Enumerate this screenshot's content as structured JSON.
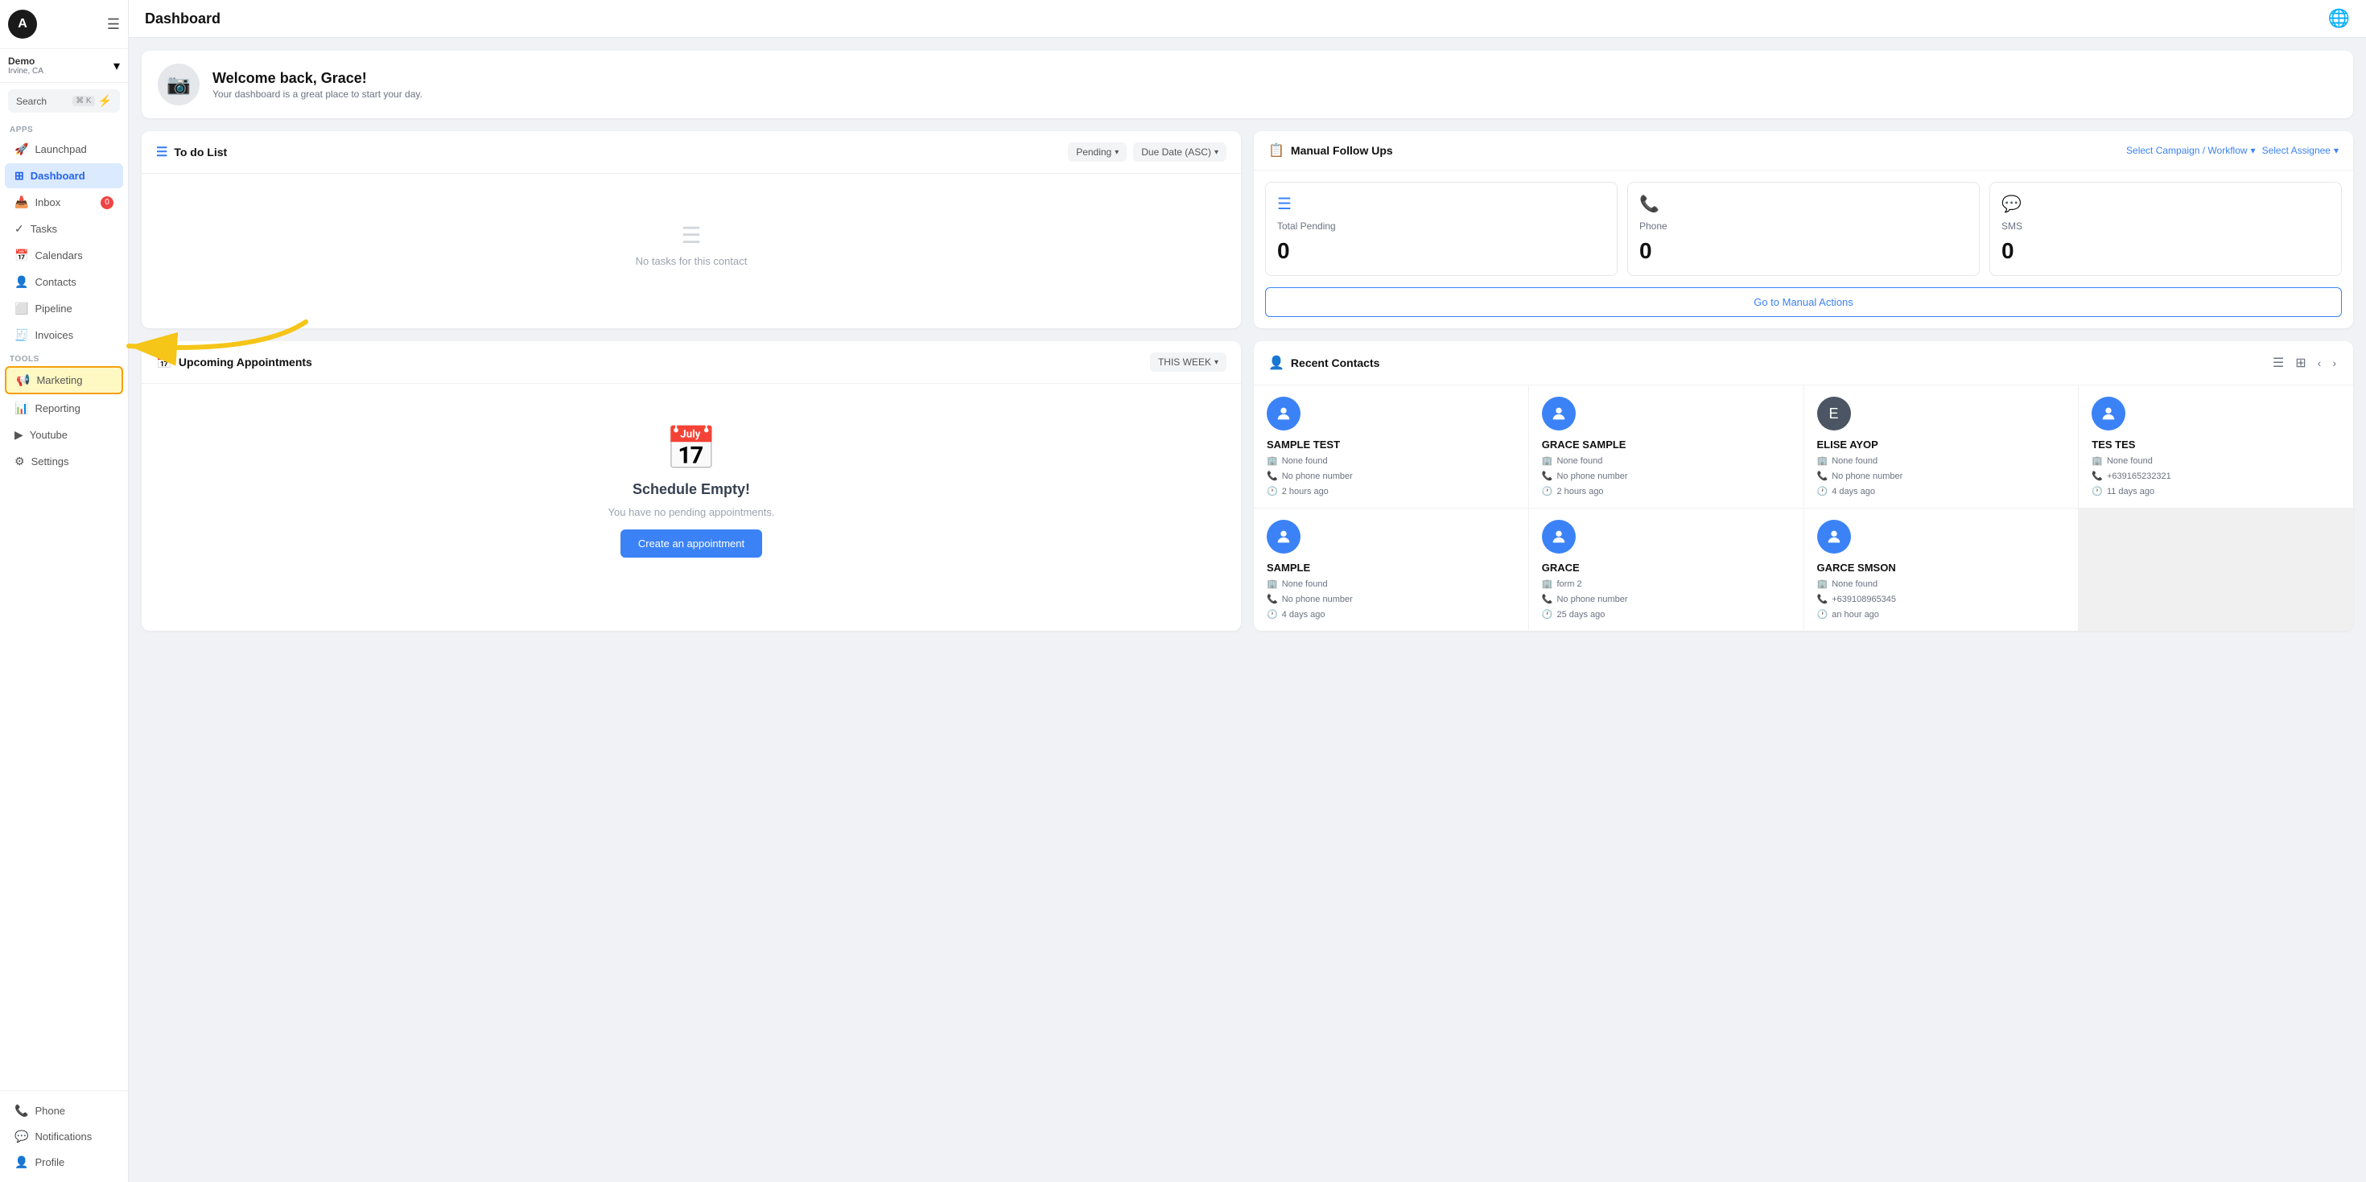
{
  "sidebar": {
    "avatar_letter": "A",
    "account": {
      "name": "Demo",
      "location": "Irvine, CA"
    },
    "search": {
      "label": "Search",
      "shortcut": "⌘ K"
    },
    "apps_label": "Apps",
    "tools_label": "Tools",
    "apps_items": [
      {
        "id": "launchpad",
        "label": "Launchpad",
        "icon": "🚀",
        "active": false
      },
      {
        "id": "dashboard",
        "label": "Dashboard",
        "icon": "⊞",
        "active": true
      },
      {
        "id": "inbox",
        "label": "Inbox",
        "icon": "📥",
        "active": false,
        "badge": "0"
      },
      {
        "id": "tasks",
        "label": "Tasks",
        "icon": "✓",
        "active": false
      },
      {
        "id": "calendars",
        "label": "Calendars",
        "icon": "📅",
        "active": false
      },
      {
        "id": "contacts",
        "label": "Contacts",
        "icon": "👤",
        "active": false
      },
      {
        "id": "pipeline",
        "label": "Pipeline",
        "icon": "⬜",
        "active": false
      },
      {
        "id": "invoices",
        "label": "Invoices",
        "icon": "🧾",
        "active": false
      }
    ],
    "tools_items": [
      {
        "id": "marketing",
        "label": "Marketing",
        "icon": "📢",
        "active": false,
        "highlighted": true
      },
      {
        "id": "reporting",
        "label": "Reporting",
        "icon": "📊",
        "active": false
      },
      {
        "id": "youtube",
        "label": "Youtube",
        "icon": "▶",
        "active": false
      },
      {
        "id": "settings",
        "label": "Settings",
        "icon": "⚙",
        "active": false
      }
    ],
    "bottom_items": [
      {
        "id": "phone",
        "label": "Phone",
        "icon": "📞"
      },
      {
        "id": "notifications",
        "label": "Notifications",
        "icon": "💬"
      },
      {
        "id": "profile",
        "label": "Profile",
        "icon": "👤"
      }
    ]
  },
  "topbar": {
    "title": "Dashboard"
  },
  "welcome": {
    "title": "Welcome back, Grace!",
    "subtitle": "Your dashboard is a great place to start your day."
  },
  "todo": {
    "title": "To do List",
    "filter_pending": "Pending",
    "filter_due": "Due Date (ASC)",
    "empty_message": "No tasks for this contact"
  },
  "manual_follow_ups": {
    "title": "Manual Follow Ups",
    "select_campaign": "Select Campaign / Workflow",
    "select_assignee": "Select Assignee",
    "stats": [
      {
        "label": "Total Pending",
        "value": "0",
        "icon": "☰"
      },
      {
        "label": "Phone",
        "value": "0",
        "icon": "📞"
      },
      {
        "label": "SMS",
        "value": "0",
        "icon": "💬"
      }
    ],
    "go_button": "Go to Manual Actions"
  },
  "upcoming_appointments": {
    "title": "Upcoming Appointments",
    "filter": "THIS WEEK",
    "empty_title": "Schedule Empty!",
    "empty_sub": "You have no pending appointments.",
    "create_btn": "Create an appointment"
  },
  "recent_contacts": {
    "title": "Recent Contacts",
    "contacts": [
      {
        "name": "SAMPLE TEST",
        "detail1": "None found",
        "detail2": "No phone number",
        "time": "2 hours ago",
        "has_photo": false
      },
      {
        "name": "GRACE SAMPLE",
        "detail1": "None found",
        "detail2": "No phone number",
        "time": "2 hours ago",
        "has_photo": false
      },
      {
        "name": "ELISE AYOP",
        "detail1": "None found",
        "detail2": "No phone number",
        "time": "4 days ago",
        "has_photo": true
      },
      {
        "name": "TES TES",
        "detail1": "None found",
        "detail2": "+639165232321",
        "time": "11 days ago",
        "has_photo": false
      },
      {
        "name": "SAMPLE",
        "detail1": "None found",
        "detail2": "No phone number",
        "time": "4 days ago",
        "has_photo": false
      },
      {
        "name": "GRACE",
        "detail1": "form 2",
        "detail2": "No phone number",
        "time": "25 days ago",
        "has_photo": false
      },
      {
        "name": "GARCE SMSON",
        "detail1": "None found",
        "detail2": "+639108965345",
        "time": "an hour ago",
        "has_photo": false
      }
    ]
  }
}
